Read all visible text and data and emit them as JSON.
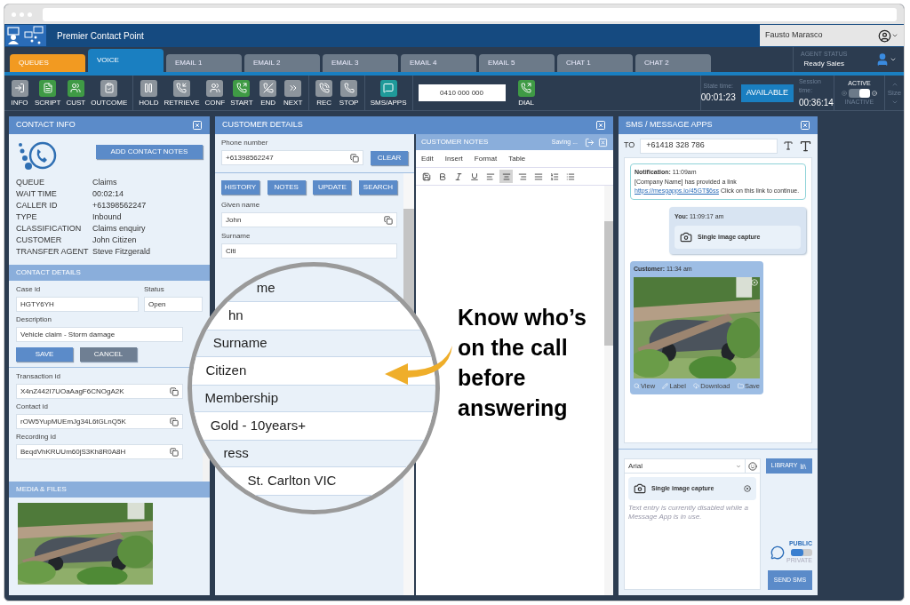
{
  "app": {
    "title": "Premier Contact Point",
    "user": "Fausto Marasco"
  },
  "tabs": [
    {
      "label": "QUEUES",
      "kind": "queue",
      "selected": false
    },
    {
      "label": "VOICE",
      "kind": "channel",
      "selected": true
    },
    {
      "label": "EMAIL 1",
      "kind": "channel",
      "selected": false
    },
    {
      "label": "EMAIL 2",
      "kind": "channel",
      "selected": false
    },
    {
      "label": "EMAIL 3",
      "kind": "channel",
      "selected": false
    },
    {
      "label": "EMAIL 4",
      "kind": "channel",
      "selected": false
    },
    {
      "label": "EMAIL 5",
      "kind": "channel",
      "selected": false
    },
    {
      "label": "CHAT 1",
      "kind": "channel",
      "selected": false
    },
    {
      "label": "CHAT 2",
      "kind": "channel",
      "selected": false
    }
  ],
  "agent_status": {
    "label": "AGENT STATUS",
    "value": "Ready Sales"
  },
  "toolbar": {
    "groups": [
      [
        {
          "label": "INFO",
          "color": "#8c949c"
        },
        {
          "label": "SCRIPT",
          "color": "#3f9a45"
        },
        {
          "label": "CUST",
          "color": "#3f9a45"
        },
        {
          "label": "OUTCOME",
          "color": "#8c949c"
        }
      ],
      [
        {
          "label": "HOLD",
          "color": "#8c949c"
        },
        {
          "label": "RETRIEVE",
          "color": "#8c949c"
        },
        {
          "label": "CONF",
          "color": "#8c949c"
        },
        {
          "label": "START",
          "color": "#3f9a45"
        },
        {
          "label": "END",
          "color": "#8c949c"
        },
        {
          "label": "NEXT",
          "color": "#8c949c"
        }
      ],
      [
        {
          "label": "REC",
          "color": "#8c949c"
        },
        {
          "label": "STOP",
          "color": "#8c949c"
        }
      ],
      [
        {
          "label": "SMS/APPS",
          "color": "#1f9a9a"
        }
      ]
    ],
    "dial_number": "0410 000 000",
    "dial_label": "DIAL",
    "state_time": {
      "label": "State time:",
      "value": "00:01:23"
    },
    "availability": "AVAILABLE",
    "session_time": {
      "label": "Session time:",
      "value": "00:36:14"
    },
    "activity": {
      "on_label": "ACTIVE",
      "off_label": "INACTIVE",
      "on": true
    },
    "size_label": "Size"
  },
  "contact_info": {
    "title": "CONTACT INFO",
    "button": "ADD CONTACT NOTES",
    "fields": [
      {
        "label": "QUEUE",
        "value": "Claims"
      },
      {
        "label": "WAIT TIME",
        "value": "00:02:14"
      },
      {
        "label": "CALLER ID",
        "value": "+61398562247"
      },
      {
        "label": "TYPE",
        "value": "Inbound"
      },
      {
        "label": "CLASSIFICATION",
        "value": "Claims enquiry"
      },
      {
        "label": "CUSTOMER",
        "value": "John Citizen"
      },
      {
        "label": "TRANSFER AGENT",
        "value": "Steve Fitzgerald"
      }
    ]
  },
  "contact_details": {
    "title": "CONTACT DETAILS",
    "case_id": {
      "label": "Case id",
      "value": "HGTY6YH"
    },
    "status": {
      "label": "Status",
      "value": "Open"
    },
    "description": {
      "label": "Description",
      "value": "Vehicle claim - Storm damage"
    },
    "save": "SAVE",
    "cancel": "CANCEL",
    "ids": [
      {
        "label": "Transaction id",
        "value": "X4nZ442I7UOaAagF6CNOgA2K"
      },
      {
        "label": "Contact id",
        "value": "rOW5YupMUEmJg34L6tGLnQ5K"
      },
      {
        "label": "Recording id",
        "value": "BeqdVhKRUUm60jS3Kh8R0A8H"
      }
    ]
  },
  "media": {
    "title": "MEDIA & FILES"
  },
  "customer_details": {
    "title": "CUSTOMER DETAILS",
    "phone": {
      "label": "Phone number",
      "value": "+61398562247"
    },
    "clear": "CLEAR",
    "buttons": [
      "HISTORY",
      "NOTES",
      "UPDATE",
      "SEARCH"
    ],
    "fields": [
      {
        "label": "Given name",
        "value": "John"
      },
      {
        "label": "Surname",
        "value": "Citi"
      }
    ]
  },
  "magnifier": [
    {
      "kind": "label",
      "text": "me"
    },
    {
      "kind": "value",
      "text": "hn"
    },
    {
      "kind": "label",
      "text": "Surname"
    },
    {
      "kind": "value",
      "text": "Citizen"
    },
    {
      "kind": "label",
      "text": "Membership"
    },
    {
      "kind": "value",
      "text": "Gold - 10years+"
    },
    {
      "kind": "label",
      "text": "ress"
    },
    {
      "kind": "value",
      "text": "St. Carlton VIC"
    }
  ],
  "callout": "Know who’s on the call before answering",
  "customer_notes": {
    "title": "CUSTOMER NOTES",
    "status": "Saving ...",
    "menu": [
      "Edit",
      "Insert",
      "Format",
      "Table"
    ],
    "format_buttons": [
      {
        "selected": false
      },
      {
        "selected": false
      },
      {
        "selected": false
      },
      {
        "selected": false
      },
      {
        "selected": false
      },
      {
        "selected": true
      },
      {
        "selected": false
      },
      {
        "selected": false
      },
      {
        "selected": false
      },
      {
        "selected": false
      }
    ]
  },
  "sms": {
    "title": "SMS / MESSAGE APPS",
    "to_label": "TO",
    "to": "+61418 328 786",
    "notification": {
      "header": "**Notification:** 11:09am",
      "text": "[Company Name] has provided a link",
      "link": "https://mesgapps.io/45GT$6ss",
      "after": "Click on this link to continue."
    },
    "you": {
      "header": "**You:** 11:09:17 am",
      "attachment": "Single image capture"
    },
    "customer": {
      "header": "**Customer:** 11:34 am",
      "actions": [
        "View",
        "Label",
        "Download",
        "Save"
      ]
    },
    "font": "Arial",
    "library": "LIBRARY",
    "attachment": "Single image capture",
    "disabled_note": "Text entry is currently disabled while a Message App is in use.",
    "visibility": [
      {
        "label": "PUBLIC",
        "selected": true
      },
      {
        "label": "PRIVATE",
        "selected": false
      }
    ],
    "send": "SEND SMS"
  }
}
